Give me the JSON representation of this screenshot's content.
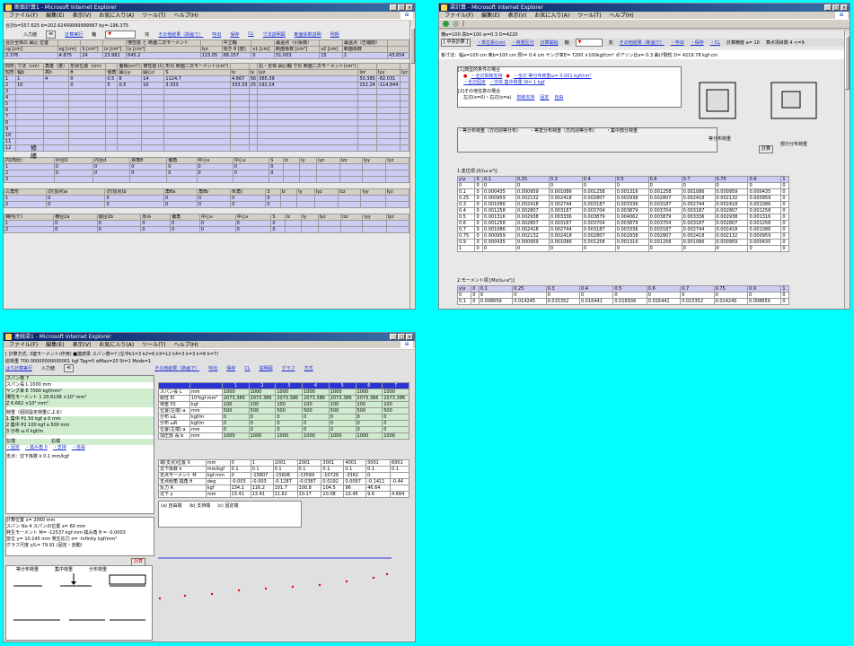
{
  "w1": {
    "title": "断面計算1 - Microsoft Internet Explorer",
    "menu": [
      "ファイル(F)",
      "編集(E)",
      "表示(V)",
      "お気に入り(A)",
      "ツール(T)",
      "ヘルプ(H)"
    ],
    "info": "合計b=557.625 b=202.62499999999997 by=-196.375",
    "toolbar": [
      "入力値",
      "計算実行",
      "軸",
      "完",
      "その他結果（新画で）",
      "呼出",
      "保存",
      "CL",
      "寸法説明図",
      "断面係数説明",
      "例題"
    ],
    "sum_headers": [
      "合計全体の 図心 位置",
      "",
      "",
      "",
      "慣性能 と 断面二次モーメント",
      "",
      "中立軸",
      "",
      "最遠点（引張側）",
      "",
      "最遠点（圧縮側）",
      ""
    ],
    "sum_sub": [
      "νg [cm]",
      "νg [cm]",
      "S [cm²]",
      "Iz [cm⁴]",
      "Iy [cm⁴]",
      "Iyz",
      "傾き θ [度]",
      "ν1 [cm]",
      "断面係数 [cm³]",
      "ν2 [cm]",
      "断面係数",
      ""
    ],
    "sum_vals": [
      "2.376",
      "4.875",
      "24",
      "23.981",
      "645.2",
      "115.05",
      "68.157",
      "0",
      "51.003",
      "15",
      "1",
      "43.654"
    ],
    "rect_headers": [
      "四形",
      "寸法（cm）",
      "角度（度）",
      "形状位置（cm）",
      "",
      "面積(cm²)",
      "慣性能 (I)",
      "形の 断面二次モーメント(cm⁴)",
      "",
      "",
      "右・全体 図心軸 での 断面二次モーメント(cm⁴)",
      "",
      ""
    ],
    "rect_sub": [
      "短形",
      "幅b",
      "高h",
      "θ",
      "傾角",
      "図心y",
      "図心z",
      "S",
      "Iz",
      "Iy",
      "Iyz",
      "Izz",
      "Iyy",
      "Iyz"
    ],
    "rect_rows": [
      [
        "1",
        "1",
        "4",
        "0",
        "0.5",
        "8",
        "14",
        "1124.7",
        "4.667",
        "56",
        "365.39",
        "50.385",
        "-82.031"
      ],
      [
        "2",
        "10",
        "",
        "0",
        "5",
        "0.5",
        "10",
        "3.333",
        "333.33",
        "25",
        "192.24",
        "152.24",
        "-114.844"
      ],
      [
        "3"
      ],
      [
        "4"
      ],
      [
        "5"
      ],
      [
        "6"
      ],
      [
        "7"
      ],
      [
        "8"
      ],
      [
        "9"
      ],
      [
        "10"
      ],
      [
        "11"
      ],
      [
        "12"
      ]
    ],
    "watermark": "修\n繕",
    "circle_headers": [
      "円(肉厚)",
      "外径D",
      "内径d",
      "挟角θ",
      "偏角",
      "中心ν",
      "中心ν",
      "S",
      "Iz",
      "Iy",
      "Iyz",
      "Izz",
      "Iyy",
      "Iyz"
    ],
    "circle_rows": [
      [
        "1",
        "0",
        "0",
        "0",
        "0",
        "0",
        "0",
        "0"
      ],
      [
        "2",
        "0",
        "0",
        "0",
        "0",
        "0",
        "0",
        "0"
      ],
      [
        "3"
      ]
    ],
    "tri_headers": [
      "三角形",
      "辺(頂点)a",
      "辺(頂点)b",
      "角θa",
      "角θb",
      "θ(角)",
      "S",
      "Iz",
      "Iy",
      "Iyz",
      "Izz",
      "Iyy",
      "Iyz"
    ],
    "tri_rows": [
      [
        "1",
        "0",
        "0",
        "0",
        "0",
        "0",
        "0"
      ],
      [
        "2",
        "0",
        "0",
        "0",
        "0",
        "0",
        "0"
      ]
    ],
    "trap_headers": [
      "梯円(ケ)",
      "横径2a",
      "縦径2b",
      "厚み",
      "偏角",
      "中心ν",
      "中心ν",
      "S",
      "Iz",
      "Iy",
      "Iyz",
      "Izz",
      "Iyy",
      "Iyz"
    ],
    "trap_rows": [
      [
        "1",
        "0",
        "0",
        "0",
        "0",
        "0",
        "0",
        "0"
      ],
      [
        "2",
        "0",
        "0",
        "0",
        "0",
        "0",
        "0",
        "0"
      ]
    ]
  },
  "w2": {
    "title": "梁計算 - Microsoft Internet Explorer",
    "menu": [
      "ファイル(F)",
      "編集(E)",
      "表示(V)",
      "お気に入り(A)",
      "ツール(T)",
      "ヘルプ(H)"
    ],
    "info": "横a=100 高b=100 w=0.3 D=4220",
    "toolbar": [
      "[ 中央計算 ]",
      "・単位系(cm)",
      "・荷重区分",
      "計算開始",
      "軸",
      "完",
      "その他結果（新画で）",
      "・呼出",
      "・保存",
      "・CL",
      "計算精度 a= 10",
      "算点項目数 4 <=9"
    ],
    "params": "板寸法：幅a=100 cm  奥b=100 cm  厚t= 0.4 cm  ヤング率E= 7200 ×100kgf/cm²  ポアソン比ν= 0.3  曲げ剛性 D= 4219.78 kgf·cm",
    "sec1": "[1]典型的条件の場合",
    "sec1_items": [
      "・全辺単純支持",
      "・全辺 等分布荷重ω= 0.001 kgf/cm²",
      "・全辺固定",
      "・中央 集中荷重 W= 1 kgf"
    ],
    "sec2": "[2]その他任意の場合",
    "sec2_row": [
      "左辺(x=0)・右辺(x=a)",
      "単純支持",
      "固定",
      "自由",
      "単純支持",
      "固定",
      "自由"
    ],
    "load_titles": [
      "・等分布荷重（方向別等分布）",
      "・等変分布荷重（方向別等分布）",
      "・集中部分荷重"
    ],
    "plate_caption": "等分布荷重",
    "plate_caption2": "部分分布荷重",
    "table1_title": "1.変位項 [δ/(ω·a⁴)]",
    "table1_header": [
      "y\\x",
      "0",
      "0.1",
      "0.25",
      "0.3",
      "0.4",
      "0.5",
      "0.6",
      "0.7",
      "0.75",
      "0.9",
      "1"
    ],
    "table1_rows": [
      [
        "0",
        "0",
        "0",
        "0",
        "0",
        "0",
        "0",
        "0",
        "0",
        "0",
        "0",
        "0"
      ],
      [
        "0.1",
        "0",
        "0.000435",
        "0.000959",
        "0.001086",
        "0.001258",
        "0.001316",
        "0.001258",
        "0.001086",
        "0.000959",
        "0.000435",
        "0"
      ],
      [
        "0.25",
        "0",
        "0.000959",
        "0.002132",
        "0.002418",
        "0.002807",
        "0.002938",
        "0.002807",
        "0.002418",
        "0.002132",
        "0.000959",
        "0"
      ],
      [
        "0.3",
        "0",
        "0.001086",
        "0.002418",
        "0.002744",
        "0.003187",
        "0.003336",
        "0.003187",
        "0.002744",
        "0.002418",
        "0.001086",
        "0"
      ],
      [
        "0.4",
        "0",
        "0.001258",
        "0.002807",
        "0.003187",
        "0.003704",
        "0.003879",
        "0.003704",
        "0.003187",
        "0.002807",
        "0.001258",
        "0"
      ],
      [
        "0.5",
        "0",
        "0.001316",
        "0.002938",
        "0.003336",
        "0.003879",
        "0.004062",
        "0.003879",
        "0.003336",
        "0.002938",
        "0.001316",
        "0"
      ],
      [
        "0.6",
        "0",
        "0.001258",
        "0.002807",
        "0.003187",
        "0.003704",
        "0.003879",
        "0.003704",
        "0.003187",
        "0.002807",
        "0.001258",
        "0"
      ],
      [
        "0.7",
        "0",
        "0.001086",
        "0.002418",
        "0.002744",
        "0.003187",
        "0.003336",
        "0.003187",
        "0.002744",
        "0.002418",
        "0.001086",
        "0"
      ],
      [
        "0.75",
        "0",
        "0.000959",
        "0.002132",
        "0.002418",
        "0.002807",
        "0.002938",
        "0.002807",
        "0.002418",
        "0.002132",
        "0.000959",
        "0"
      ],
      [
        "0.9",
        "0",
        "0.000435",
        "0.000959",
        "0.001086",
        "0.001258",
        "0.001316",
        "0.001258",
        "0.001086",
        "0.000959",
        "0.000435",
        "0"
      ],
      [
        "1",
        "0",
        "0",
        "0",
        "0",
        "0",
        "0",
        "0",
        "0",
        "0",
        "0",
        "0"
      ]
    ],
    "table2_title": "2.モーメント項 [Mx/(ω·a²)]",
    "table2_rows": [
      [
        "0",
        "0",
        "0",
        "0",
        "0",
        "0",
        "0",
        "0",
        "0",
        "0",
        "0",
        "0"
      ],
      [
        "0.1",
        "0",
        "0.008659",
        "0.014245",
        "0.015352",
        "0.016441",
        "0.016936",
        "0.016441",
        "0.015352",
        "0.014245",
        "0.008659",
        "0"
      ]
    ]
  },
  "w3": {
    "title": "連続梁1 - Microsoft Internet Explorer",
    "menu": [
      "ファイル(F)",
      "編集(E)",
      "表示(V)",
      "お気に入り(A)",
      "ツール(T)",
      "ヘルプ(H)"
    ],
    "info1": "[ 計算方式: 3連モーメント(作用) ■連続梁  スパン数=7  (左中k1=3 k2=6 k3=12 k4=3  k=3  k=6  k=7)",
    "info2": "総荷重 700.00000000000001  kgf  Tag=0 wMax=20 St=1 Mode=1",
    "toolbar": [
      "はり計算実行",
      "入力値",
      "その他結果（新画で）",
      "呼出",
      "保存",
      "CL",
      "説明図",
      "グラフ",
      "方式"
    ],
    "span_label": "スパン数 7",
    "span_len": "スパン長 L 1000  mm",
    "young": "ヤング率 E 7000 kgf/mm²",
    "inertia": "慣性モーメント 1 20.6198 ×10⁴ mm⁴",
    "section": "Z 6.662 ×10³ mm³",
    "load_title": "荷重（個別設定荷重による）",
    "loads": [
      "1 集中 P1 50 kgf  a 0 mm",
      "2 集中 P2 100 kgf  a 500 mm",
      "3 分布 ω 0  kgf/m"
    ],
    "left_end": "左端",
    "right_end": "右端",
    "support": "支点：沈下係数 k 0.1 mm/kgf",
    "calc_pos": "計算位置 x= 2060 mm",
    "span_no": "スパン No 4   スパンの位置 x= 60 mm",
    "moment_res": "発生モーメント M= -12537 kgf·mm  撓み角 θ = -0.0003",
    "disp_res": "変位 y= 10.145 mm  発生応力 σ= -Infinity kgf/mm²",
    "graph": "グラフ尺度 y/L= 79.91  (固定・自動)",
    "calc_btn": "計算",
    "col_nums": [
      "1",
      "2",
      "3",
      "4",
      "5",
      "6",
      "7"
    ],
    "grid_labels": [
      "スパン長 L",
      "剛性 EI",
      "荷重 P2",
      "位置(左端) a",
      "分布 ωL",
      "分布 ωR",
      "位置(左端) a",
      "加圧部 長 b"
    ],
    "grid_units": [
      "mm",
      "10⁴kgf·mm²",
      "kgf",
      "mm",
      "kgf/m",
      "kgf/m",
      "mm",
      "mm"
    ],
    "grid_rows": [
      [
        "1000",
        "1000",
        "1000",
        "1000",
        "1000",
        "1000",
        "1000"
      ],
      [
        "2073.386",
        "2073.386",
        "2073.386",
        "2073.386",
        "2073.386",
        "2073.386",
        "2073.386"
      ],
      [
        "100",
        "100",
        "100",
        "100",
        "100",
        "100",
        "100"
      ],
      [
        "500",
        "500",
        "500",
        "500",
        "500",
        "500",
        "500"
      ],
      [
        "0",
        "0",
        "0",
        "0",
        "0",
        "0",
        "0"
      ],
      [
        "0",
        "0",
        "0",
        "0",
        "0",
        "0",
        "0"
      ],
      [
        "0",
        "0",
        "0",
        "0",
        "0",
        "0",
        "0"
      ],
      [
        "1000",
        "1000",
        "1000",
        "1000",
        "1000",
        "1000",
        "1000"
      ]
    ],
    "res_labels": [
      "端(支点)位置 X",
      "沈下係数 k",
      "支点モーメント M",
      "支点傾角 撓角 θ",
      "反力 R",
      "沈下 y"
    ],
    "res_units": [
      "mm",
      "mm/kgf",
      "kgf·mm",
      "deg",
      "kgf",
      "mm"
    ],
    "res_rows": [
      [
        "0",
        "1",
        "1001",
        "2001",
        "3001",
        "4001",
        "5001",
        "6001"
      ],
      [
        "0.1",
        "0.1",
        "0.1",
        "0.1",
        "0.1",
        "0.1",
        "0.1",
        "0.1"
      ],
      [
        "0",
        "-15807",
        "-15606",
        "-13584",
        "-10726",
        "-3362",
        "0",
        ""
      ],
      [
        "-0.003",
        "-0.003",
        "-0.1287",
        "-0.0387",
        "0.0192",
        "0.0097",
        "-0.1411",
        "-0.44"
      ],
      [
        "134.1",
        "116.2",
        "101.7",
        "100.8",
        "104.5",
        "96",
        "46.64",
        ""
      ],
      [
        "13.41",
        "13.41",
        "11.62",
        "10.17",
        "10.08",
        "10.45",
        "9.6",
        "4.664"
      ]
    ],
    "support_types": [
      "(a) 自由端",
      "(b) 支持端",
      "(c) 固定端"
    ],
    "load_types": [
      "等分布荷重",
      "集中荷重",
      "分布荷重"
    ],
    "side_labels": [
      "左端",
      "右端",
      "支点"
    ],
    "opts": [
      "・固定",
      "・撓み角 0",
      "・支持",
      "・自由"
    ]
  }
}
